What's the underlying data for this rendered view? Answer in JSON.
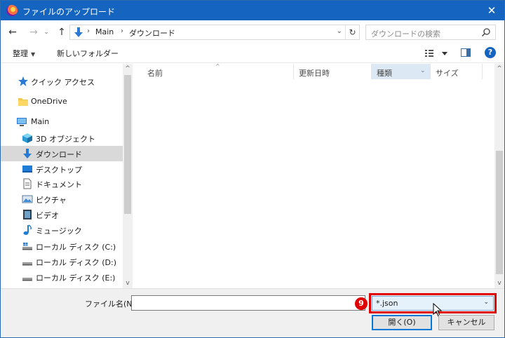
{
  "window": {
    "title": "ファイルのアップロード",
    "close_glyph": "✕"
  },
  "address_bar": {
    "back": "←",
    "forward": "→",
    "recent": "⌄",
    "up": "↑",
    "breadcrumbs": [
      "Main",
      "ダウンロード"
    ],
    "separator": "›",
    "dropdown": "⌄",
    "refresh": "↻"
  },
  "search": {
    "placeholder": "ダウンロードの検索"
  },
  "toolbar": {
    "organize_label": "整理",
    "organize_caret": "▼",
    "new_folder_label": "新しいフォルダー",
    "help_glyph": "?"
  },
  "nav": {
    "items": [
      {
        "label": "クイック アクセス",
        "icon": "star-icon"
      },
      {
        "label": "OneDrive",
        "icon": "folder-icon"
      },
      {
        "label": "Main",
        "icon": "computer-icon"
      },
      {
        "label": "3D オブジェクト",
        "icon": "cube-icon"
      },
      {
        "label": "ダウンロード",
        "icon": "download-icon",
        "selected": true
      },
      {
        "label": "デスクトップ",
        "icon": "desktop-icon"
      },
      {
        "label": "ドキュメント",
        "icon": "document-icon"
      },
      {
        "label": "ピクチャ",
        "icon": "picture-icon"
      },
      {
        "label": "ビデオ",
        "icon": "video-icon"
      },
      {
        "label": "ミュージック",
        "icon": "music-icon"
      },
      {
        "label": "ローカル ディスク (C:)",
        "icon": "disk-icon"
      },
      {
        "label": "ローカル ディスク (D:)",
        "icon": "disk-icon"
      },
      {
        "label": "ローカル ディスク (E:)",
        "icon": "disk-icon"
      }
    ],
    "scroll_up": "^",
    "scroll_down": "v"
  },
  "file_list": {
    "columns": {
      "name": "名前",
      "date": "更新日時",
      "type": "種類",
      "size": "サイズ"
    },
    "sort_indicator": "^",
    "type_menu": "⌄",
    "scroll_up": "^",
    "scroll_down": "v"
  },
  "bottom": {
    "filename_label": "ファイル名(N):",
    "filename_value": "",
    "filter_value": "*.json",
    "filter_chevron": "⌄",
    "step_badge": "9",
    "open_label": "開く(O)",
    "cancel_label": "キャンセル",
    "highlight_color": "#e00000"
  },
  "colors": {
    "titlebar": "#1565c0",
    "selection": "#d9d9d9",
    "accent": "#0078d7"
  }
}
